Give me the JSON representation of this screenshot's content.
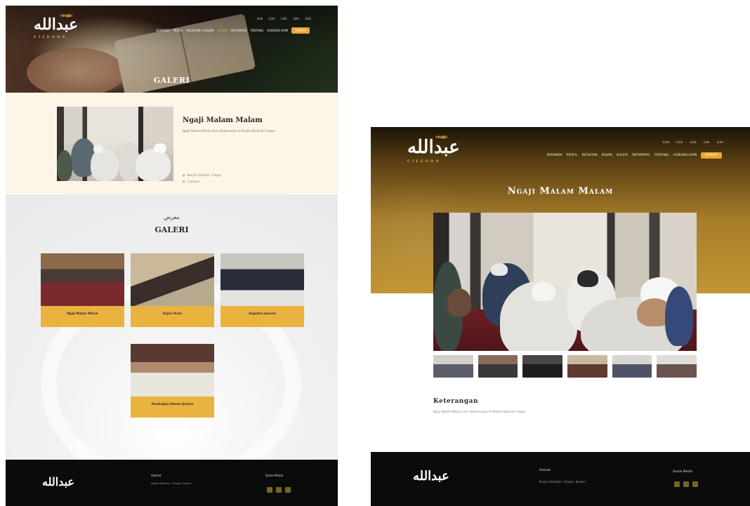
{
  "left": {
    "logo": {
      "text": "عبدالله",
      "tagline": "CILEGON",
      "badge": "MASJID"
    },
    "top_links": [
      "Link",
      "Link",
      "Link",
      "Link",
      "Link"
    ],
    "nav": {
      "items": [
        "BERANDA",
        "PROFIL",
        "KEGIATAN & KAJIAN",
        "GALERI",
        "INFORMASI",
        "TENTANG",
        "HUBUNGI KAMI"
      ],
      "active": "GALERI",
      "cta": "DONASI"
    },
    "hero_title": "GALERI",
    "detail": {
      "title": "Ngaji Malam Malam",
      "description": "Ngaji Malam Malam rutin dilaksanakan di Masjid Abdullah Cilegon",
      "location": "Masjid Abdullah, Cilegon",
      "date": "1 Januari"
    },
    "gallery": {
      "arabic_label": "معرض",
      "title": "GALERI",
      "items": [
        {
          "caption": "Ngaji Malam Malam"
        },
        {
          "caption": "Kajian Rutin"
        },
        {
          "caption": "Kegiatan Jamaah"
        },
        {
          "caption": "Pembagian Hewan Qurban"
        }
      ]
    },
    "footer": {
      "logo": "عبدالله",
      "address_heading": "Alamat",
      "address": "Masjid Abdullah, Cilegon, Banten",
      "social_heading": "Sosial Media"
    }
  },
  "right": {
    "logo": {
      "text": "عبدالله",
      "tagline": "CILEGON",
      "badge": "MASJID"
    },
    "top_links": [
      "Link",
      "Link",
      "Link",
      "Link",
      "Link"
    ],
    "nav": {
      "items": [
        "BERANDA",
        "PROFIL",
        "KEGIATAN",
        "KAJIAN",
        "GALERI",
        "INFORMASI",
        "TENTANG",
        "HUBUNGI KAMI"
      ],
      "cta": "DONASI"
    },
    "title": "Ngaji Malam Malam",
    "keterangan_heading": "Keterangan",
    "keterangan_text": "Ngaji Malam Malam rutin dilaksanakan di Masjid Abdullah Cilegon",
    "footer": {
      "logo": "عبدالله",
      "address_heading": "Alamat",
      "address": "Masjid Abdullah, Cilegon, Banten",
      "social_heading": "Sosial Media"
    }
  },
  "colors": {
    "accent": "#e9a52e",
    "footer": "#0b0b0b",
    "cream": "#fdf5e6",
    "gold": "#c29634"
  }
}
